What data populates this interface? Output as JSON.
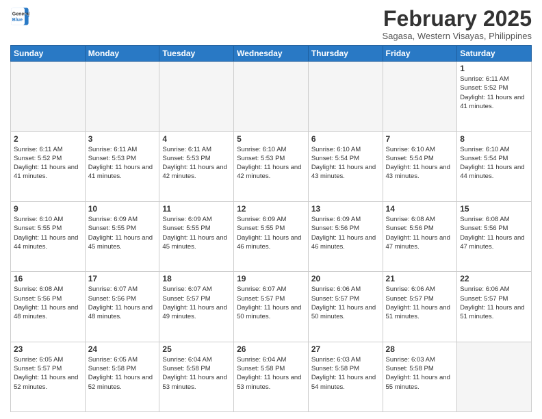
{
  "header": {
    "logo_line1": "General",
    "logo_line2": "Blue",
    "month": "February 2025",
    "location": "Sagasa, Western Visayas, Philippines"
  },
  "days_of_week": [
    "Sunday",
    "Monday",
    "Tuesday",
    "Wednesday",
    "Thursday",
    "Friday",
    "Saturday"
  ],
  "weeks": [
    [
      {
        "day": "",
        "info": ""
      },
      {
        "day": "",
        "info": ""
      },
      {
        "day": "",
        "info": ""
      },
      {
        "day": "",
        "info": ""
      },
      {
        "day": "",
        "info": ""
      },
      {
        "day": "",
        "info": ""
      },
      {
        "day": "1",
        "info": "Sunrise: 6:11 AM\nSunset: 5:52 PM\nDaylight: 11 hours and 41 minutes."
      }
    ],
    [
      {
        "day": "2",
        "info": "Sunrise: 6:11 AM\nSunset: 5:52 PM\nDaylight: 11 hours and 41 minutes."
      },
      {
        "day": "3",
        "info": "Sunrise: 6:11 AM\nSunset: 5:53 PM\nDaylight: 11 hours and 41 minutes."
      },
      {
        "day": "4",
        "info": "Sunrise: 6:11 AM\nSunset: 5:53 PM\nDaylight: 11 hours and 42 minutes."
      },
      {
        "day": "5",
        "info": "Sunrise: 6:10 AM\nSunset: 5:53 PM\nDaylight: 11 hours and 42 minutes."
      },
      {
        "day": "6",
        "info": "Sunrise: 6:10 AM\nSunset: 5:54 PM\nDaylight: 11 hours and 43 minutes."
      },
      {
        "day": "7",
        "info": "Sunrise: 6:10 AM\nSunset: 5:54 PM\nDaylight: 11 hours and 43 minutes."
      },
      {
        "day": "8",
        "info": "Sunrise: 6:10 AM\nSunset: 5:54 PM\nDaylight: 11 hours and 44 minutes."
      }
    ],
    [
      {
        "day": "9",
        "info": "Sunrise: 6:10 AM\nSunset: 5:55 PM\nDaylight: 11 hours and 44 minutes."
      },
      {
        "day": "10",
        "info": "Sunrise: 6:09 AM\nSunset: 5:55 PM\nDaylight: 11 hours and 45 minutes."
      },
      {
        "day": "11",
        "info": "Sunrise: 6:09 AM\nSunset: 5:55 PM\nDaylight: 11 hours and 45 minutes."
      },
      {
        "day": "12",
        "info": "Sunrise: 6:09 AM\nSunset: 5:55 PM\nDaylight: 11 hours and 46 minutes."
      },
      {
        "day": "13",
        "info": "Sunrise: 6:09 AM\nSunset: 5:56 PM\nDaylight: 11 hours and 46 minutes."
      },
      {
        "day": "14",
        "info": "Sunrise: 6:08 AM\nSunset: 5:56 PM\nDaylight: 11 hours and 47 minutes."
      },
      {
        "day": "15",
        "info": "Sunrise: 6:08 AM\nSunset: 5:56 PM\nDaylight: 11 hours and 47 minutes."
      }
    ],
    [
      {
        "day": "16",
        "info": "Sunrise: 6:08 AM\nSunset: 5:56 PM\nDaylight: 11 hours and 48 minutes."
      },
      {
        "day": "17",
        "info": "Sunrise: 6:07 AM\nSunset: 5:56 PM\nDaylight: 11 hours and 48 minutes."
      },
      {
        "day": "18",
        "info": "Sunrise: 6:07 AM\nSunset: 5:57 PM\nDaylight: 11 hours and 49 minutes."
      },
      {
        "day": "19",
        "info": "Sunrise: 6:07 AM\nSunset: 5:57 PM\nDaylight: 11 hours and 50 minutes."
      },
      {
        "day": "20",
        "info": "Sunrise: 6:06 AM\nSunset: 5:57 PM\nDaylight: 11 hours and 50 minutes."
      },
      {
        "day": "21",
        "info": "Sunrise: 6:06 AM\nSunset: 5:57 PM\nDaylight: 11 hours and 51 minutes."
      },
      {
        "day": "22",
        "info": "Sunrise: 6:06 AM\nSunset: 5:57 PM\nDaylight: 11 hours and 51 minutes."
      }
    ],
    [
      {
        "day": "23",
        "info": "Sunrise: 6:05 AM\nSunset: 5:57 PM\nDaylight: 11 hours and 52 minutes."
      },
      {
        "day": "24",
        "info": "Sunrise: 6:05 AM\nSunset: 5:58 PM\nDaylight: 11 hours and 52 minutes."
      },
      {
        "day": "25",
        "info": "Sunrise: 6:04 AM\nSunset: 5:58 PM\nDaylight: 11 hours and 53 minutes."
      },
      {
        "day": "26",
        "info": "Sunrise: 6:04 AM\nSunset: 5:58 PM\nDaylight: 11 hours and 53 minutes."
      },
      {
        "day": "27",
        "info": "Sunrise: 6:03 AM\nSunset: 5:58 PM\nDaylight: 11 hours and 54 minutes."
      },
      {
        "day": "28",
        "info": "Sunrise: 6:03 AM\nSunset: 5:58 PM\nDaylight: 11 hours and 55 minutes."
      },
      {
        "day": "",
        "info": ""
      }
    ]
  ]
}
